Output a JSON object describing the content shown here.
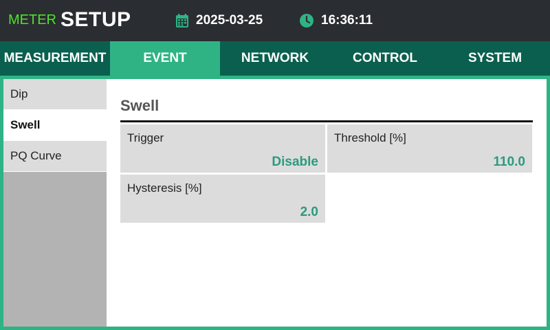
{
  "header": {
    "brand_meter": "METER",
    "brand_setup": "SETUP",
    "date": "2025-03-25",
    "time": "16:36:11",
    "date_icon": "calendar-icon",
    "time_icon": "clock-icon"
  },
  "tabs": [
    {
      "label": "MEASUREMENT",
      "active": false
    },
    {
      "label": "EVENT",
      "active": true
    },
    {
      "label": "NETWORK",
      "active": false
    },
    {
      "label": "CONTROL",
      "active": false
    },
    {
      "label": "SYSTEM",
      "active": false
    }
  ],
  "sidebar": {
    "items": [
      {
        "label": "Dip",
        "active": false
      },
      {
        "label": "Swell",
        "active": true
      },
      {
        "label": "PQ Curve",
        "active": false
      }
    ]
  },
  "main": {
    "title": "Swell",
    "fields": {
      "trigger": {
        "label": "Trigger",
        "value": "Disable"
      },
      "threshold": {
        "label": "Threshold [%]",
        "value": "110.0"
      },
      "hysteresis": {
        "label": "Hysteresis [%]",
        "value": "2.0"
      }
    }
  },
  "colors": {
    "accent": "#2fb385",
    "tab_bar": "#0b5f4f",
    "header_bg": "#2a2d31",
    "brand_green": "#4fe32a",
    "value_text": "#2a9a7f"
  }
}
